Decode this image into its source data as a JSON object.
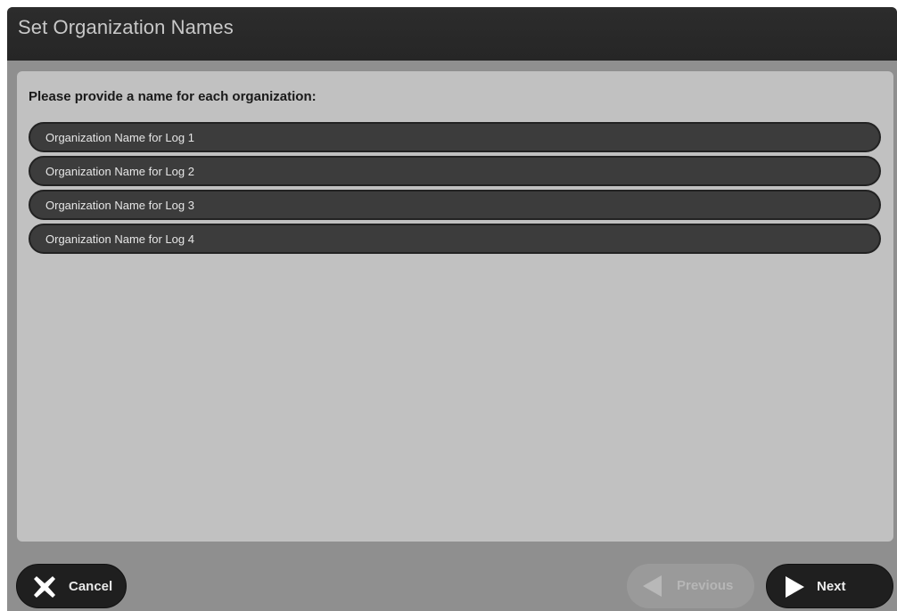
{
  "window": {
    "title": "Set Organization Names"
  },
  "content": {
    "prompt": "Please provide a name for each organization:",
    "fields": [
      {
        "placeholder": "Organization Name for Log 1",
        "value": ""
      },
      {
        "placeholder": "Organization Name for Log 2",
        "value": ""
      },
      {
        "placeholder": "Organization Name for Log 3",
        "value": ""
      },
      {
        "placeholder": "Organization Name for Log 4",
        "value": ""
      }
    ]
  },
  "footer": {
    "cancel_label": "Cancel",
    "cancel_icon": "close-icon",
    "previous_label": "Previous",
    "previous_icon": "arrow-left-icon",
    "next_label": "Next",
    "next_icon": "arrow-right-icon"
  },
  "colors": {
    "title_bar": "#282828",
    "panel": "#c1c1c1",
    "field_bg": "#3c3c3c",
    "button_dark": "#1f1f1f",
    "button_disabled": "#9a9a9a"
  }
}
